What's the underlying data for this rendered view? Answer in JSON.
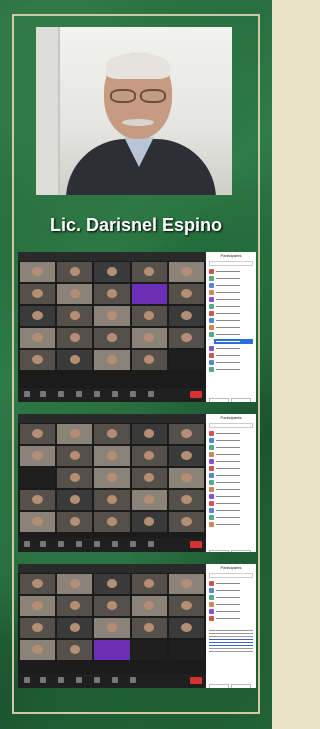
{
  "caption": "Lic. Darisnel Espino",
  "photo": {
    "icon": "speaker-portrait"
  },
  "screenshots": [
    {
      "app": "zoom-gallery-view",
      "panel_title": "Participants",
      "highlight_row": true
    },
    {
      "app": "zoom-gallery-view",
      "panel_title": "Participants",
      "highlight_row": false
    },
    {
      "app": "zoom-gallery-view",
      "panel_title": "Participants",
      "chat_visible": true
    }
  ],
  "colors": {
    "background_green": "#2a7040",
    "frame": "#cfc9a5",
    "zoom_dark": "#1b1b1b",
    "accent_blue": "#2d6cdf",
    "end_red": "#d93030"
  }
}
